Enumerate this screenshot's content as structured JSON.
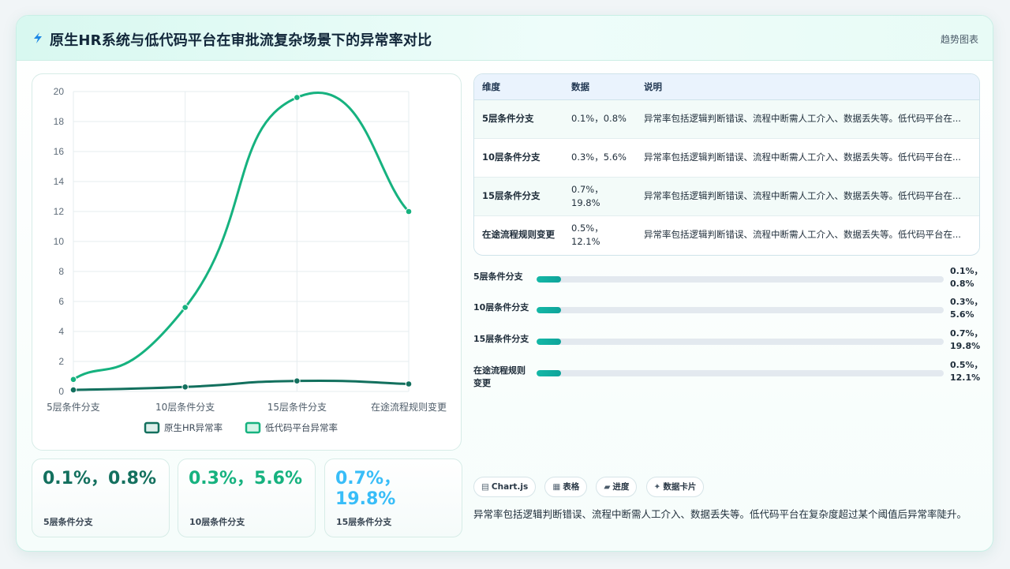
{
  "header": {
    "title": "原生HR系统与低代码平台在审批流复杂场景下的异常率对比",
    "tag": "趋势图表"
  },
  "colors": {
    "native": "#13705e",
    "lowcode": "#16b27f",
    "stat1": "#13705e",
    "stat2": "#16b27f",
    "stat3": "#38bdf8"
  },
  "chart_data": {
    "type": "line",
    "categories": [
      "5层条件分支",
      "10层条件分支",
      "15层条件分支",
      "在途流程规则变更"
    ],
    "series": [
      {
        "name": "原生HR异常率",
        "values": [
          0.1,
          0.3,
          0.7,
          0.5
        ]
      },
      {
        "name": "低代码平台异常率",
        "values": [
          0.8,
          5.6,
          19.6,
          12.0
        ]
      }
    ],
    "ylim": [
      0,
      20
    ],
    "yticks": [
      "0",
      "2",
      "4",
      "6",
      "8",
      "10",
      "12",
      "14",
      "16",
      "18",
      "20"
    ],
    "grid": true,
    "legend": "bottom"
  },
  "stats": [
    {
      "value": "0.1%，0.8%",
      "label": "5层条件分支"
    },
    {
      "value": "0.3%，5.6%",
      "label": "10层条件分支"
    },
    {
      "value": "0.7%，19.8%",
      "label": "15层条件分支"
    }
  ],
  "table": {
    "headers": [
      "维度",
      "数据",
      "说明"
    ],
    "rows": [
      {
        "dim": "5层条件分支",
        "data": "0.1%，0.8%",
        "desc": "异常率包括逻辑判断错误、流程中断需人工介入、数据丢失等。低代码平台在..."
      },
      {
        "dim": "10层条件分支",
        "data": "0.3%，5.6%",
        "desc": "异常率包括逻辑判断错误、流程中断需人工介入、数据丢失等。低代码平台在..."
      },
      {
        "dim": "15层条件分支",
        "data": "0.7%，19.8%",
        "desc": "异常率包括逻辑判断错误、流程中断需人工介入、数据丢失等。低代码平台在..."
      },
      {
        "dim": "在途流程规则变更",
        "data": "0.5%，12.1%",
        "desc": "异常率包括逻辑判断错误、流程中断需人工介入、数据丢失等。低代码平台在..."
      }
    ]
  },
  "progress": [
    {
      "label": "5层条件分支",
      "value": "0.1%，0.8%",
      "fill": 0.06
    },
    {
      "label": "10层条件分支",
      "value": "0.3%，5.6%",
      "fill": 0.06
    },
    {
      "label": "15层条件分支",
      "value": "0.7%，19.8%",
      "fill": 0.06
    },
    {
      "label": "在途流程规则变更",
      "value": "0.5%，12.1%",
      "fill": 0.06
    }
  ],
  "chips": [
    {
      "icon": "chart-icon",
      "glyph": "▤",
      "label": "Chart.js"
    },
    {
      "icon": "table-icon",
      "glyph": "▦",
      "label": "表格"
    },
    {
      "icon": "progress-icon",
      "glyph": "▰",
      "label": "进度"
    },
    {
      "icon": "sparkle-icon",
      "glyph": "✦",
      "label": "数据卡片"
    }
  ],
  "note": "异常率包括逻辑判断错误、流程中断需人工介入、数据丢失等。低代码平台在复杂度超过某个阈值后异常率陡升。"
}
